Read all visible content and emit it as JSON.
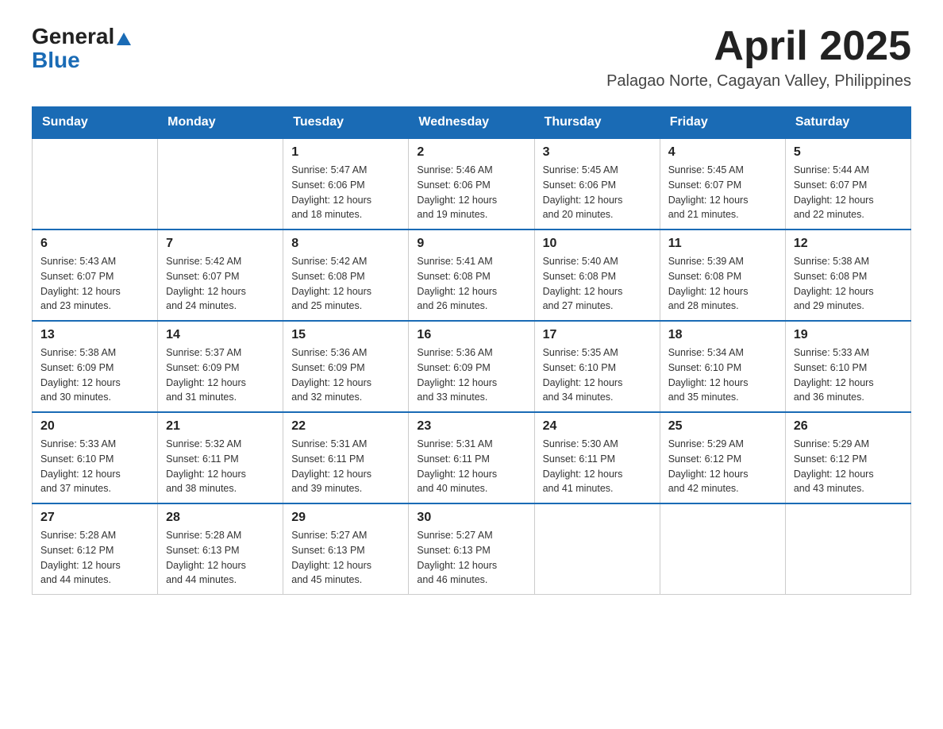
{
  "header": {
    "logo_general": "General",
    "logo_blue": "Blue",
    "month_title": "April 2025",
    "location": "Palagao Norte, Cagayan Valley, Philippines"
  },
  "days_of_week": [
    "Sunday",
    "Monday",
    "Tuesday",
    "Wednesday",
    "Thursday",
    "Friday",
    "Saturday"
  ],
  "weeks": [
    {
      "days": [
        {
          "num": "",
          "info": ""
        },
        {
          "num": "",
          "info": ""
        },
        {
          "num": "1",
          "info": "Sunrise: 5:47 AM\nSunset: 6:06 PM\nDaylight: 12 hours\nand 18 minutes."
        },
        {
          "num": "2",
          "info": "Sunrise: 5:46 AM\nSunset: 6:06 PM\nDaylight: 12 hours\nand 19 minutes."
        },
        {
          "num": "3",
          "info": "Sunrise: 5:45 AM\nSunset: 6:06 PM\nDaylight: 12 hours\nand 20 minutes."
        },
        {
          "num": "4",
          "info": "Sunrise: 5:45 AM\nSunset: 6:07 PM\nDaylight: 12 hours\nand 21 minutes."
        },
        {
          "num": "5",
          "info": "Sunrise: 5:44 AM\nSunset: 6:07 PM\nDaylight: 12 hours\nand 22 minutes."
        }
      ]
    },
    {
      "days": [
        {
          "num": "6",
          "info": "Sunrise: 5:43 AM\nSunset: 6:07 PM\nDaylight: 12 hours\nand 23 minutes."
        },
        {
          "num": "7",
          "info": "Sunrise: 5:42 AM\nSunset: 6:07 PM\nDaylight: 12 hours\nand 24 minutes."
        },
        {
          "num": "8",
          "info": "Sunrise: 5:42 AM\nSunset: 6:08 PM\nDaylight: 12 hours\nand 25 minutes."
        },
        {
          "num": "9",
          "info": "Sunrise: 5:41 AM\nSunset: 6:08 PM\nDaylight: 12 hours\nand 26 minutes."
        },
        {
          "num": "10",
          "info": "Sunrise: 5:40 AM\nSunset: 6:08 PM\nDaylight: 12 hours\nand 27 minutes."
        },
        {
          "num": "11",
          "info": "Sunrise: 5:39 AM\nSunset: 6:08 PM\nDaylight: 12 hours\nand 28 minutes."
        },
        {
          "num": "12",
          "info": "Sunrise: 5:38 AM\nSunset: 6:08 PM\nDaylight: 12 hours\nand 29 minutes."
        }
      ]
    },
    {
      "days": [
        {
          "num": "13",
          "info": "Sunrise: 5:38 AM\nSunset: 6:09 PM\nDaylight: 12 hours\nand 30 minutes."
        },
        {
          "num": "14",
          "info": "Sunrise: 5:37 AM\nSunset: 6:09 PM\nDaylight: 12 hours\nand 31 minutes."
        },
        {
          "num": "15",
          "info": "Sunrise: 5:36 AM\nSunset: 6:09 PM\nDaylight: 12 hours\nand 32 minutes."
        },
        {
          "num": "16",
          "info": "Sunrise: 5:36 AM\nSunset: 6:09 PM\nDaylight: 12 hours\nand 33 minutes."
        },
        {
          "num": "17",
          "info": "Sunrise: 5:35 AM\nSunset: 6:10 PM\nDaylight: 12 hours\nand 34 minutes."
        },
        {
          "num": "18",
          "info": "Sunrise: 5:34 AM\nSunset: 6:10 PM\nDaylight: 12 hours\nand 35 minutes."
        },
        {
          "num": "19",
          "info": "Sunrise: 5:33 AM\nSunset: 6:10 PM\nDaylight: 12 hours\nand 36 minutes."
        }
      ]
    },
    {
      "days": [
        {
          "num": "20",
          "info": "Sunrise: 5:33 AM\nSunset: 6:10 PM\nDaylight: 12 hours\nand 37 minutes."
        },
        {
          "num": "21",
          "info": "Sunrise: 5:32 AM\nSunset: 6:11 PM\nDaylight: 12 hours\nand 38 minutes."
        },
        {
          "num": "22",
          "info": "Sunrise: 5:31 AM\nSunset: 6:11 PM\nDaylight: 12 hours\nand 39 minutes."
        },
        {
          "num": "23",
          "info": "Sunrise: 5:31 AM\nSunset: 6:11 PM\nDaylight: 12 hours\nand 40 minutes."
        },
        {
          "num": "24",
          "info": "Sunrise: 5:30 AM\nSunset: 6:11 PM\nDaylight: 12 hours\nand 41 minutes."
        },
        {
          "num": "25",
          "info": "Sunrise: 5:29 AM\nSunset: 6:12 PM\nDaylight: 12 hours\nand 42 minutes."
        },
        {
          "num": "26",
          "info": "Sunrise: 5:29 AM\nSunset: 6:12 PM\nDaylight: 12 hours\nand 43 minutes."
        }
      ]
    },
    {
      "days": [
        {
          "num": "27",
          "info": "Sunrise: 5:28 AM\nSunset: 6:12 PM\nDaylight: 12 hours\nand 44 minutes."
        },
        {
          "num": "28",
          "info": "Sunrise: 5:28 AM\nSunset: 6:13 PM\nDaylight: 12 hours\nand 44 minutes."
        },
        {
          "num": "29",
          "info": "Sunrise: 5:27 AM\nSunset: 6:13 PM\nDaylight: 12 hours\nand 45 minutes."
        },
        {
          "num": "30",
          "info": "Sunrise: 5:27 AM\nSunset: 6:13 PM\nDaylight: 12 hours\nand 46 minutes."
        },
        {
          "num": "",
          "info": ""
        },
        {
          "num": "",
          "info": ""
        },
        {
          "num": "",
          "info": ""
        }
      ]
    }
  ]
}
